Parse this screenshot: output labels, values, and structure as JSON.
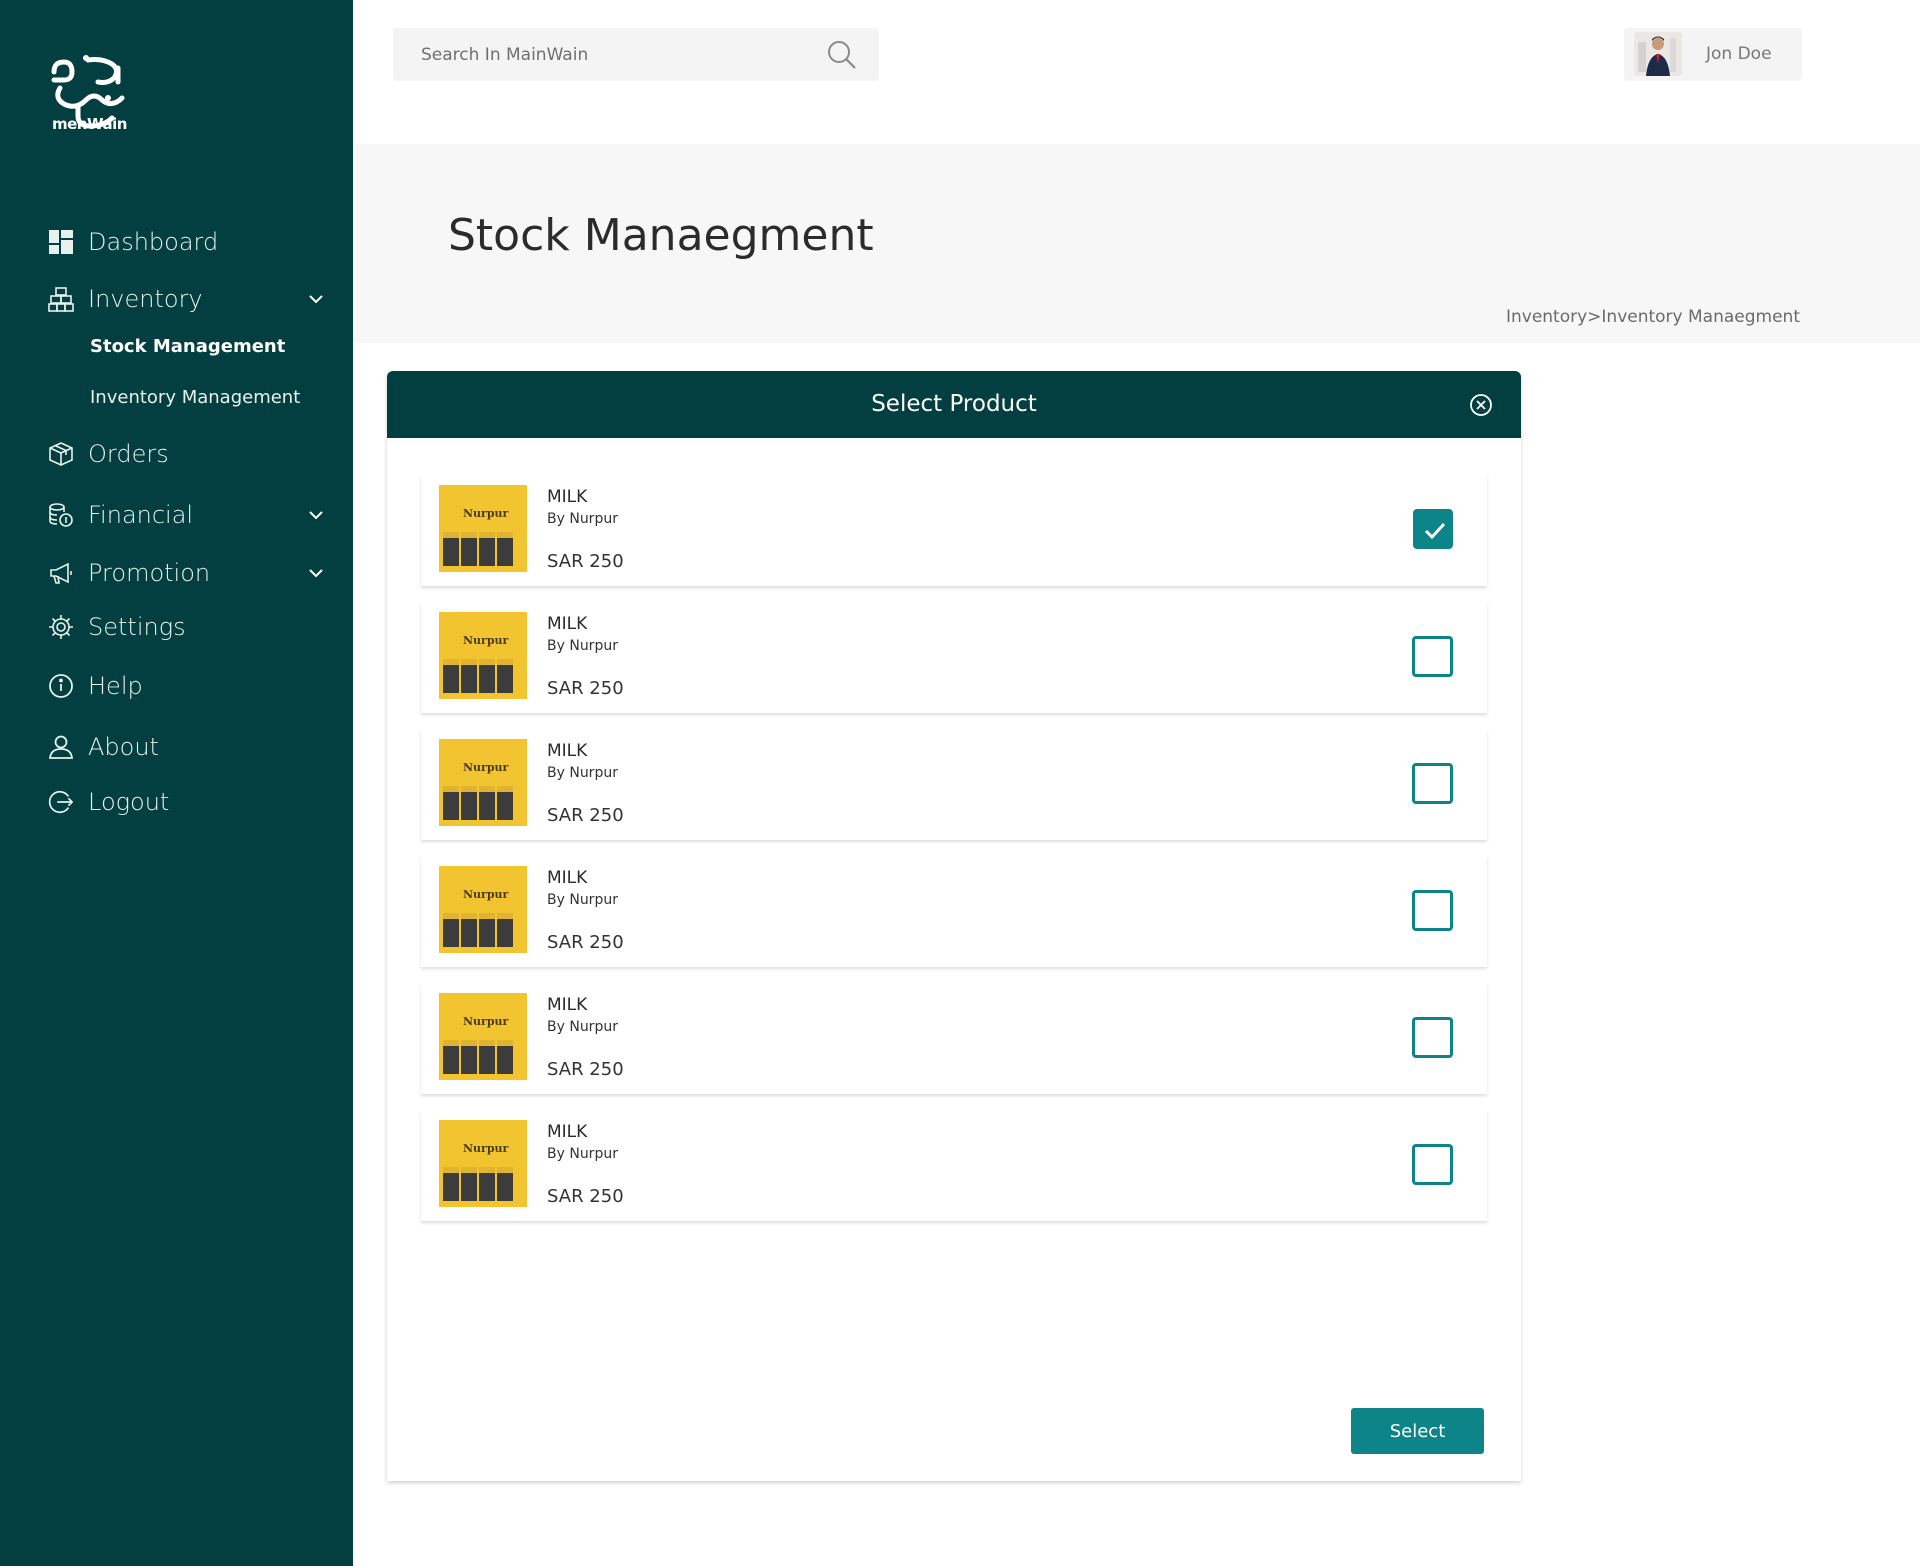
{
  "brand": {
    "logo_text": "menWain"
  },
  "sidebar": {
    "items": [
      {
        "key": "dashboard",
        "label": "Dashboard",
        "icon": "dashboard-icon"
      },
      {
        "key": "inventory",
        "label": "Inventory",
        "icon": "inventory-icon"
      },
      {
        "key": "orders",
        "label": "Orders",
        "icon": "box-icon"
      },
      {
        "key": "financial",
        "label": "Financial",
        "icon": "coins-icon"
      },
      {
        "key": "promotion",
        "label": "Promotion",
        "icon": "megaphone-icon"
      },
      {
        "key": "settings",
        "label": "Settings",
        "icon": "gear-icon"
      },
      {
        "key": "help",
        "label": "Help",
        "icon": "info-icon"
      },
      {
        "key": "about",
        "label": "About",
        "icon": "user-icon"
      },
      {
        "key": "logout",
        "label": "Logout",
        "icon": "logout-icon"
      }
    ],
    "inventory_sub": [
      "Stock Management",
      "Inventory Management"
    ]
  },
  "search": {
    "placeholder": "Search In MainWain"
  },
  "user": {
    "name": "Jon Doe"
  },
  "page": {
    "title": "Stock Manaegment",
    "breadcrumb": "Inventory>Inventory Manaegment"
  },
  "modal": {
    "title": "Select Product",
    "select_label": "Select",
    "products": [
      {
        "name": "MILK",
        "by": "By Nurpur",
        "price": "SAR 250",
        "checked": true,
        "thumb_brand": "Nurpur"
      },
      {
        "name": "MILK",
        "by": "By Nurpur",
        "price": "SAR 250",
        "checked": false,
        "thumb_brand": "Nurpur"
      },
      {
        "name": "MILK",
        "by": "By Nurpur",
        "price": "SAR 250",
        "checked": false,
        "thumb_brand": "Nurpur"
      },
      {
        "name": "MILK",
        "by": "By Nurpur",
        "price": "SAR 250",
        "checked": false,
        "thumb_brand": "Nurpur"
      },
      {
        "name": "MILK",
        "by": "By Nurpur",
        "price": "SAR 250",
        "checked": false,
        "thumb_brand": "Nurpur"
      },
      {
        "name": "MILK",
        "by": "By Nurpur",
        "price": "SAR 250",
        "checked": false,
        "thumb_brand": "Nurpur"
      }
    ]
  },
  "colors": {
    "sidebar": "#033f40",
    "accent": "#0d8488"
  }
}
